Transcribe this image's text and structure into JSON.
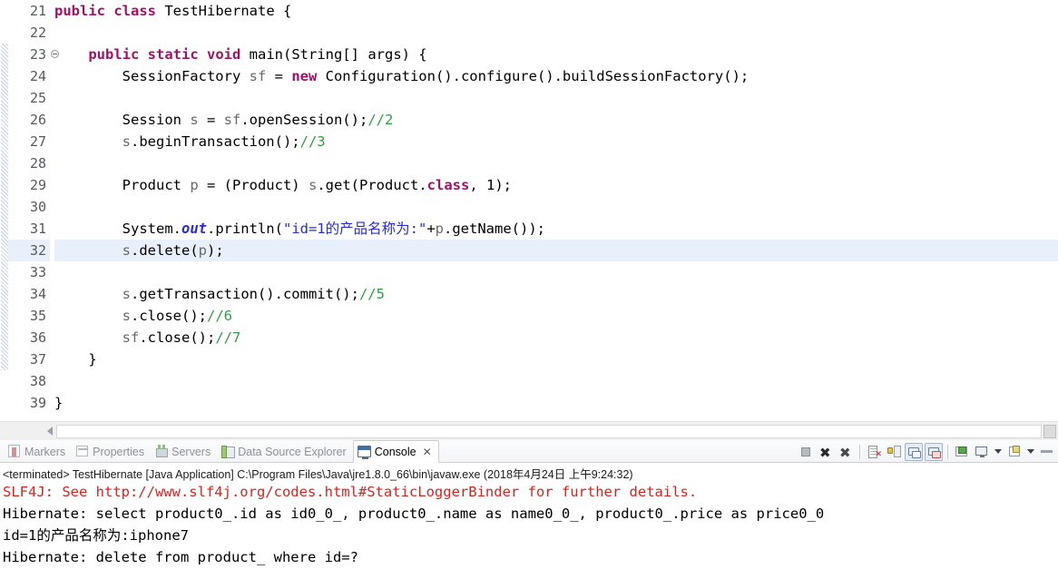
{
  "editor": {
    "first_line_number": 21,
    "highlighted_line": 32,
    "fold_marker_line": 23,
    "lines": [
      {
        "num": 21,
        "tokens": [
          {
            "t": "public",
            "c": "kw"
          },
          {
            "t": " ",
            "c": "plain"
          },
          {
            "t": "class",
            "c": "kw"
          },
          {
            "t": " TestHibernate {",
            "c": "plain"
          }
        ]
      },
      {
        "num": 22,
        "tokens": []
      },
      {
        "num": 23,
        "fold": true,
        "tokens": [
          {
            "t": "    ",
            "c": "plain"
          },
          {
            "t": "public",
            "c": "kw"
          },
          {
            "t": " ",
            "c": "plain"
          },
          {
            "t": "static",
            "c": "kw"
          },
          {
            "t": " ",
            "c": "plain"
          },
          {
            "t": "void",
            "c": "kw"
          },
          {
            "t": " main(String[] args) {",
            "c": "plain"
          }
        ]
      },
      {
        "num": 24,
        "tokens": [
          {
            "t": "        SessionFactory ",
            "c": "plain"
          },
          {
            "t": "sf",
            "c": "fld"
          },
          {
            "t": " = ",
            "c": "plain"
          },
          {
            "t": "new",
            "c": "kw"
          },
          {
            "t": " Configuration().configure().buildSessionFactory();",
            "c": "plain"
          }
        ]
      },
      {
        "num": 25,
        "tokens": []
      },
      {
        "num": 26,
        "tokens": [
          {
            "t": "        Session ",
            "c": "plain"
          },
          {
            "t": "s",
            "c": "fld"
          },
          {
            "t": " = ",
            "c": "plain"
          },
          {
            "t": "sf",
            "c": "fld"
          },
          {
            "t": ".openSession();",
            "c": "plain"
          },
          {
            "t": "//2",
            "c": "cmt"
          }
        ]
      },
      {
        "num": 27,
        "tokens": [
          {
            "t": "        ",
            "c": "plain"
          },
          {
            "t": "s",
            "c": "fld"
          },
          {
            "t": ".beginTransaction();",
            "c": "plain"
          },
          {
            "t": "//3",
            "c": "cmt"
          }
        ]
      },
      {
        "num": 28,
        "tokens": []
      },
      {
        "num": 29,
        "tokens": [
          {
            "t": "        Product ",
            "c": "plain"
          },
          {
            "t": "p",
            "c": "fld"
          },
          {
            "t": " = (Product) ",
            "c": "plain"
          },
          {
            "t": "s",
            "c": "fld"
          },
          {
            "t": ".get(Product.",
            "c": "plain"
          },
          {
            "t": "class",
            "c": "kw"
          },
          {
            "t": ", 1);",
            "c": "plain"
          }
        ]
      },
      {
        "num": 30,
        "tokens": []
      },
      {
        "num": 31,
        "tokens": [
          {
            "t": "        System.",
            "c": "plain"
          },
          {
            "t": "out",
            "c": "stat"
          },
          {
            "t": ".println(",
            "c": "plain"
          },
          {
            "t": "\"id=1的产品名称为:\"",
            "c": "str"
          },
          {
            "t": "+",
            "c": "plain"
          },
          {
            "t": "p",
            "c": "fld"
          },
          {
            "t": ".getName());",
            "c": "plain"
          }
        ]
      },
      {
        "num": 32,
        "tokens": [
          {
            "t": "        ",
            "c": "plain"
          },
          {
            "t": "s",
            "c": "fld"
          },
          {
            "t": ".delete(",
            "c": "plain"
          },
          {
            "t": "p",
            "c": "fld"
          },
          {
            "t": ");",
            "c": "plain"
          }
        ]
      },
      {
        "num": 33,
        "tokens": []
      },
      {
        "num": 34,
        "tokens": [
          {
            "t": "        ",
            "c": "plain"
          },
          {
            "t": "s",
            "c": "fld"
          },
          {
            "t": ".getTransaction().commit();",
            "c": "plain"
          },
          {
            "t": "//5",
            "c": "cmt"
          }
        ]
      },
      {
        "num": 35,
        "tokens": [
          {
            "t": "        ",
            "c": "plain"
          },
          {
            "t": "s",
            "c": "fld"
          },
          {
            "t": ".close();",
            "c": "plain"
          },
          {
            "t": "//6",
            "c": "cmt"
          }
        ]
      },
      {
        "num": 36,
        "tokens": [
          {
            "t": "        ",
            "c": "plain"
          },
          {
            "t": "sf",
            "c": "fld"
          },
          {
            "t": ".close();",
            "c": "plain"
          },
          {
            "t": "//7",
            "c": "cmt"
          }
        ]
      },
      {
        "num": 37,
        "tokens": [
          {
            "t": "    }",
            "c": "plain"
          }
        ]
      },
      {
        "num": 38,
        "tokens": []
      },
      {
        "num": 39,
        "tokens": [
          {
            "t": "}",
            "c": "plain"
          }
        ]
      }
    ],
    "colors": {
      "keyword": "#a31166",
      "string": "#2a2ae0",
      "comment": "#2f9e44",
      "field": "#6a6a6a",
      "static_field": "#2a2ae0",
      "current_line_highlight": "#e8f0fb"
    }
  },
  "panel": {
    "tabs": [
      {
        "label": "Markers",
        "icon": "markers-icon",
        "active": false
      },
      {
        "label": "Properties",
        "icon": "properties-icon",
        "active": false
      },
      {
        "label": "Servers",
        "icon": "servers-icon",
        "active": false
      },
      {
        "label": "Data Source Explorer",
        "icon": "data-source-explorer-icon",
        "active": false
      },
      {
        "label": "Console",
        "icon": "console-icon",
        "active": true,
        "close": "✕"
      }
    ],
    "toolbar": [
      {
        "name": "terminate-button",
        "glyph": "stop-icon"
      },
      {
        "name": "remove-launch-button",
        "glyph": "remove-icon"
      },
      {
        "name": "remove-all-terminated-button",
        "glyph": "remove-all-icon"
      },
      {
        "name": "separator-1",
        "glyph": "separator"
      },
      {
        "name": "clear-console-button",
        "glyph": "clear-console-icon"
      },
      {
        "name": "scroll-lock-button",
        "glyph": "scroll-lock-icon"
      },
      {
        "name": "show-console-on-output-button",
        "glyph": "console-output-icon"
      },
      {
        "name": "show-console-on-error-button",
        "glyph": "console-error-icon"
      },
      {
        "name": "separator-2",
        "glyph": "separator"
      },
      {
        "name": "pin-console-button",
        "glyph": "pin-icon"
      },
      {
        "name": "display-selected-console-button",
        "glyph": "monitor-icon"
      },
      {
        "name": "display-selected-console-menu",
        "glyph": "dropdown-arrow"
      },
      {
        "name": "open-console-button",
        "glyph": "new-console-icon"
      },
      {
        "name": "open-console-menu",
        "glyph": "dropdown-arrow"
      },
      {
        "name": "minimize-button",
        "glyph": "minimize-icon"
      }
    ],
    "terminated_line": "<terminated> TestHibernate [Java Application] C:\\Program Files\\Java\\jre1.8.0_66\\bin\\javaw.exe (2018年4月24日 上午9:24:32)",
    "output": [
      {
        "text": "SLF4J: See http://www.slf4j.org/codes.html#StaticLoggerBinder for further details.",
        "stream": "error"
      },
      {
        "text": "Hibernate: select product0_.id as id0_0_, product0_.name as name0_0_, product0_.price as price0_0",
        "stream": "out"
      },
      {
        "text": "id=1的产品名称为:iphone7",
        "stream": "out"
      },
      {
        "text": "Hibernate: delete from product_ where id=?",
        "stream": "out"
      }
    ]
  }
}
